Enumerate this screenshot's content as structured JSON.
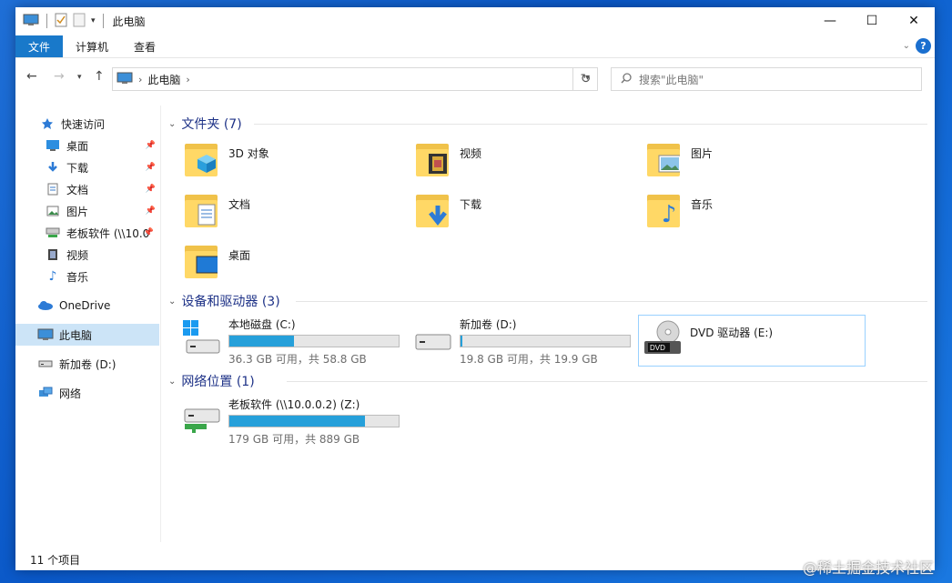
{
  "window": {
    "title": "此电脑"
  },
  "ribbon": {
    "tabs": [
      "文件",
      "计算机",
      "查看"
    ]
  },
  "address": {
    "path": "此电脑",
    "search_placeholder": "搜索\"此电脑\""
  },
  "sidebar": {
    "items": [
      {
        "label": "快速访问",
        "icon": "star-icon",
        "pinned": false
      },
      {
        "label": "桌面",
        "icon": "desktop-icon",
        "pinned": true
      },
      {
        "label": "下载",
        "icon": "download-icon",
        "pinned": true
      },
      {
        "label": "文档",
        "icon": "document-icon",
        "pinned": true
      },
      {
        "label": "图片",
        "icon": "picture-icon",
        "pinned": true
      },
      {
        "label": "老板软件 (\\\\10.0",
        "icon": "network-drive-icon",
        "pinned": true
      },
      {
        "label": "视频",
        "icon": "video-icon",
        "pinned": false
      },
      {
        "label": "音乐",
        "icon": "music-icon",
        "pinned": false
      },
      {
        "label": "OneDrive",
        "icon": "cloud-icon",
        "pinned": false
      },
      {
        "label": "此电脑",
        "icon": "pc-icon",
        "pinned": false
      },
      {
        "label": "新加卷 (D:)",
        "icon": "drive-icon",
        "pinned": false
      },
      {
        "label": "网络",
        "icon": "network-icon",
        "pinned": false
      }
    ]
  },
  "groups": {
    "folders": {
      "title": "文件夹 (7)",
      "items": [
        "3D 对象",
        "视频",
        "图片",
        "文档",
        "下载",
        "音乐",
        "桌面"
      ]
    },
    "devices": {
      "title": "设备和驱动器 (3)",
      "items": [
        {
          "name": "本地磁盘 (C:)",
          "usage": "36.3 GB 可用，共 58.8 GB",
          "used_fraction": 0.38
        },
        {
          "name": "新加卷 (D:)",
          "usage": "19.8 GB 可用，共 19.9 GB",
          "used_fraction": 0.01
        },
        {
          "name": "DVD 驱动器 (E:)",
          "usage": "",
          "used_fraction": 0
        }
      ]
    },
    "network": {
      "title": "网络位置 (1)",
      "items": [
        {
          "name": "老板软件 (\\\\10.0.0.2) (Z:)",
          "usage": "179 GB 可用，共 889 GB",
          "used_fraction": 0.8
        }
      ]
    }
  },
  "status": {
    "count": "11 个项目"
  },
  "watermark": "@稀土掘金技术社区",
  "colors": {
    "accent": "#1979ca",
    "bar_fill": "#26a0da",
    "group_header": "#1e3287",
    "selected": "#cce4f7"
  }
}
